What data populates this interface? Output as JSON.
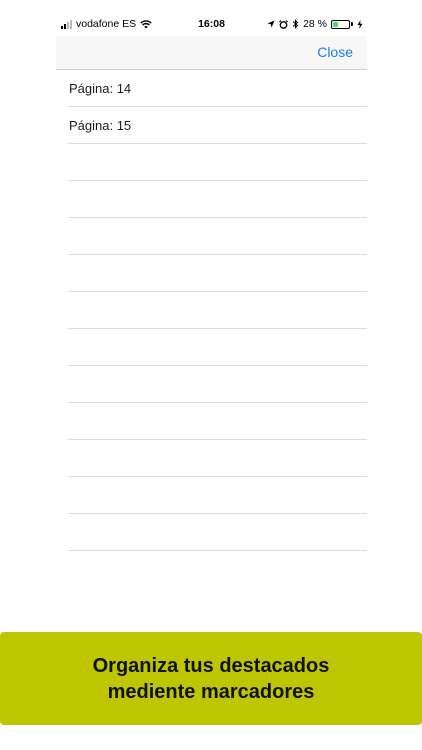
{
  "status_bar": {
    "carrier": "vodafone ES",
    "time": "16:08",
    "battery_percent": "28 %",
    "battery_level": 0.28,
    "icons": [
      "signal-icon",
      "wifi-icon",
      "location-icon",
      "alarm-icon",
      "bluetooth-icon",
      "battery-icon",
      "charging-icon"
    ]
  },
  "nav": {
    "close_label": "Close"
  },
  "bookmarks": {
    "items": [
      {
        "label": "Página: 14"
      },
      {
        "label": "Página: 15"
      }
    ],
    "empty_rows": 11
  },
  "banner": {
    "text": "Organiza tus destacados\nmediente marcadores",
    "color": "#bdc600"
  },
  "colors": {
    "accent": "#1a7ee8",
    "battery": "#4cd964"
  }
}
